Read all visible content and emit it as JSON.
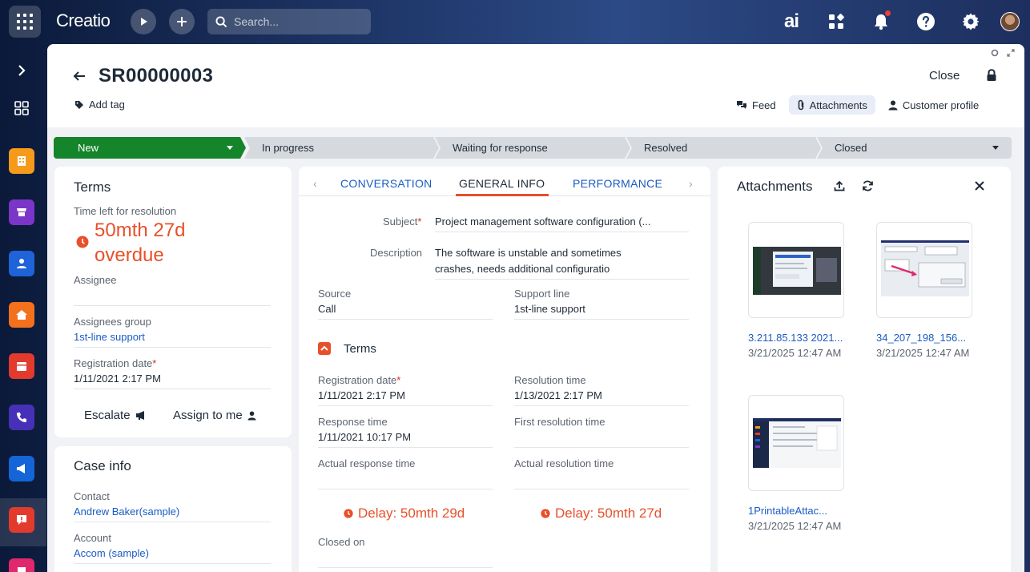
{
  "topbar": {
    "logo": "Creatio",
    "search_placeholder": "Search...",
    "ai_label": "ai"
  },
  "header": {
    "title": "SR00000003",
    "add_tag": "Add tag",
    "close": "Close",
    "actions": [
      {
        "label": "Feed"
      },
      {
        "label": "Attachments"
      },
      {
        "label": "Customer profile"
      }
    ]
  },
  "stages": [
    {
      "label": "New"
    },
    {
      "label": "In progress"
    },
    {
      "label": "Waiting for response"
    },
    {
      "label": "Resolved"
    },
    {
      "label": "Closed"
    }
  ],
  "terms_panel": {
    "title": "Terms",
    "time_left_label": "Time left for resolution",
    "overdue": "50mth 27d overdue",
    "assignee_label": "Assignee",
    "assignee_value": "",
    "group_label": "Assignees group",
    "group_value": "1st-line support",
    "reg_date_label": "Registration date",
    "reg_date_value": "1/11/2021 2:17 PM",
    "escalate": "Escalate",
    "assign_to_me": "Assign to me"
  },
  "case_info": {
    "title": "Case info",
    "contact_label": "Contact",
    "contact_value": "Andrew Baker(sample)",
    "account_label": "Account",
    "account_value": "Accom (sample)"
  },
  "center": {
    "tabs": [
      "CONVERSATION",
      "GENERAL INFO",
      "PERFORMANCE"
    ],
    "subject_label": "Subject",
    "subject_value": "Project management software configuration (...",
    "description_label": "Description",
    "description_line1": "The software is unstable and sometimes",
    "description_line2": "crashes, needs additional configuratio",
    "source_label": "Source",
    "source_value": "Call",
    "support_line_label": "Support line",
    "support_line_value": "1st-line support",
    "terms_section": "Terms",
    "reg_date_label": "Registration date",
    "reg_date_value": "1/11/2021 2:17 PM",
    "resolution_time_label": "Resolution time",
    "resolution_time_value": "1/13/2021 2:17 PM",
    "response_time_label": "Response time",
    "response_time_value": "1/11/2021 10:17 PM",
    "first_resolution_label": "First resolution time",
    "actual_response_label": "Actual response time",
    "actual_resolution_label": "Actual resolution time",
    "delay_response": "Delay: 50mth 29d",
    "delay_resolution": "Delay: 50mth 27d",
    "closed_on_label": "Closed on"
  },
  "attachments": {
    "title": "Attachments",
    "items": [
      {
        "name": "3.211.85.133 2021...",
        "date": "3/21/2025 12:47 AM"
      },
      {
        "name": "34_207_198_156...",
        "date": "3/21/2025 12:47 AM"
      },
      {
        "name": "1PrintableAttac...",
        "date": "3/21/2025 12:47 AM"
      }
    ]
  },
  "colors": {
    "accent": "#1a5bc6",
    "stage_active": "#14852a",
    "overdue": "#e8502a"
  }
}
